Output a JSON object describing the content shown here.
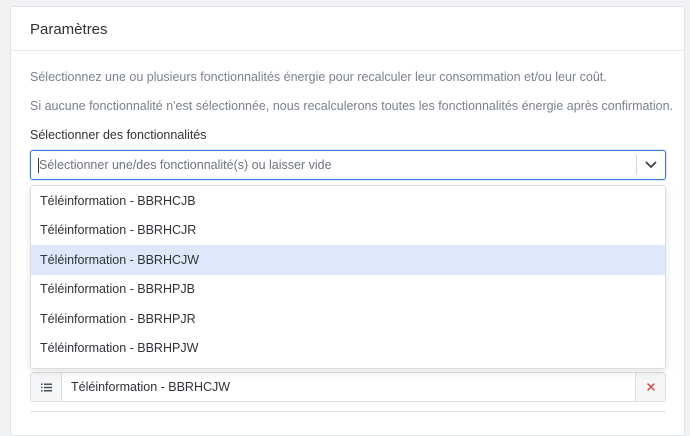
{
  "card": {
    "title": "Paramètres",
    "description_1": "Sélectionnez une ou plusieurs fonctionnalités énergie pour recalculer leur consommation et/ou leur coût.",
    "description_2": "Si aucune fonctionnalité n'est sélectionnée, nous recalculerons toutes les fonctionnalités énergie après confirmation."
  },
  "select": {
    "label": "Sélectionner des fonctionnalités",
    "placeholder": "Sélectionner une/des fonctionnalité(s) ou laisser vide",
    "value": "",
    "toggle_icon": "chevron-down-icon"
  },
  "dropdown": {
    "options": [
      {
        "label": "Téléinformation - BBRHCJB",
        "highlighted": false
      },
      {
        "label": "Téléinformation - BBRHCJR",
        "highlighted": false
      },
      {
        "label": "Téléinformation - BBRHCJW",
        "highlighted": true
      },
      {
        "label": "Téléinformation - BBRHPJB",
        "highlighted": false
      },
      {
        "label": "Téléinformation - BBRHPJR",
        "highlighted": false
      },
      {
        "label": "Téléinformation - BBRHPJW",
        "highlighted": false
      }
    ]
  },
  "selected_items": [
    {
      "label": "Téléinformation - BBRHCJW",
      "handle_icon": "list-icon",
      "remove_icon": "close-icon"
    }
  ],
  "colors": {
    "accent": "#3a7bd5",
    "highlight": "#dde9fa",
    "remove": "#d64545"
  }
}
